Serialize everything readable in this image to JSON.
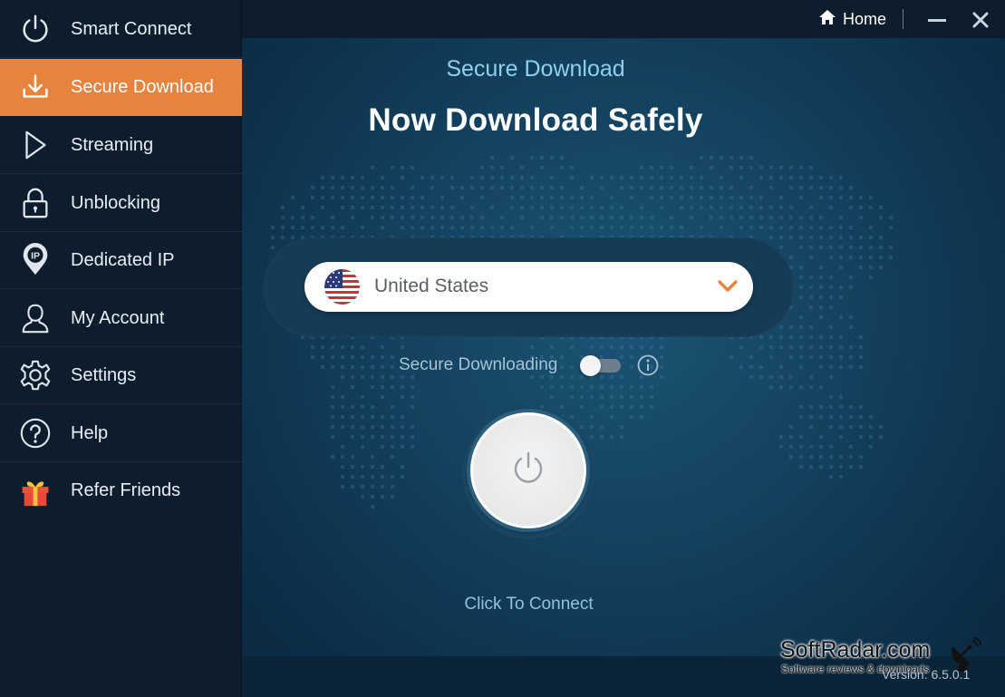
{
  "sidebar": {
    "items": [
      {
        "label": "Smart Connect",
        "icon": "power-icon"
      },
      {
        "label": "Secure Download",
        "icon": "download-icon",
        "active": true
      },
      {
        "label": "Streaming",
        "icon": "play-icon"
      },
      {
        "label": "Unblocking",
        "icon": "lock-icon"
      },
      {
        "label": "Dedicated IP",
        "icon": "ip-pin-icon"
      },
      {
        "label": "My Account",
        "icon": "user-icon"
      },
      {
        "label": "Settings",
        "icon": "gear-icon"
      },
      {
        "label": "Help",
        "icon": "help-icon"
      },
      {
        "label": "Refer Friends",
        "icon": "gift-icon"
      }
    ]
  },
  "titlebar": {
    "home_label": "Home"
  },
  "main": {
    "subtitle": "Secure Download",
    "title": "Now Download Safely",
    "country": {
      "selected": "United States",
      "flag": "us-flag-icon"
    },
    "toggle": {
      "label": "Secure Downloading",
      "on": false
    },
    "connect_label": "Click To Connect",
    "version": "Version:  6.5.0.1"
  },
  "watermark": {
    "title": "SoftRadar.com",
    "subtitle": "Software reviews & downloads"
  },
  "colors": {
    "accent": "#e6833f",
    "sidebar_bg": "#0e1d2e",
    "main_bg": "#13405d",
    "subtitle": "#8fd0ee"
  }
}
